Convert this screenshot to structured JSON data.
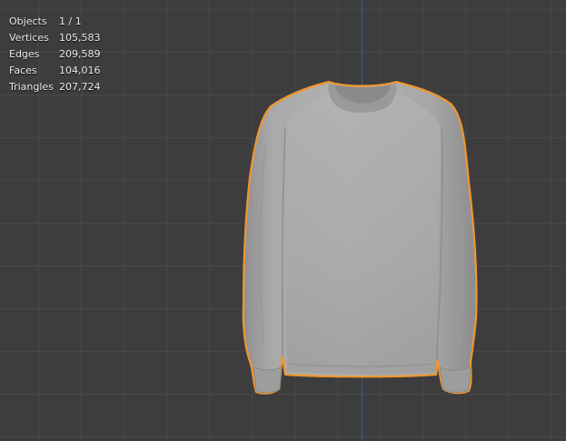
{
  "stats": [
    {
      "label": "Objects",
      "value": "1 / 1"
    },
    {
      "label": "Vertices",
      "value": "105,583"
    },
    {
      "label": "Edges",
      "value": "209,589"
    },
    {
      "label": "Faces",
      "value": "104,016"
    },
    {
      "label": "Triangles",
      "value": "207,724"
    }
  ],
  "colors": {
    "background": "#3d3d3d",
    "grid": "#484848",
    "z_axis": "#3b5d93",
    "selection_outline": "#f0962f",
    "mesh": "#a6a6a6"
  }
}
